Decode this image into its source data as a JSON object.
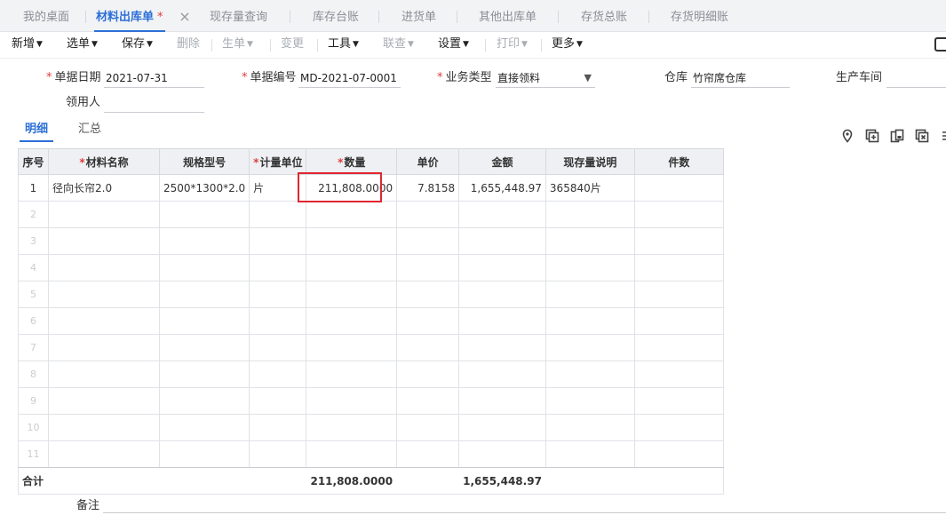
{
  "tabs": [
    {
      "label": "我的桌面",
      "active": false
    },
    {
      "label": "材料出库单",
      "active": true,
      "modified_mark": "*"
    },
    {
      "label": "现存量查询",
      "active": false
    },
    {
      "label": "库存台账",
      "active": false
    },
    {
      "label": "进货单",
      "active": false
    },
    {
      "label": "其他出库单",
      "active": false
    },
    {
      "label": "存货总账",
      "active": false
    },
    {
      "label": "存货明细账",
      "active": false
    }
  ],
  "toolbar": {
    "new": "新增",
    "select": "选单",
    "save": "保存",
    "delete": "删除",
    "generate": "生单",
    "change": "变更",
    "tools": "工具",
    "linked_query": "联查",
    "settings": "设置",
    "print": "打印",
    "more": "更多"
  },
  "form": {
    "date_label": "单据日期",
    "date_value": "2021-07-31",
    "number_label": "单据编号",
    "number_value": "MD-2021-07-0001",
    "biz_type_label": "业务类型",
    "biz_type_value": "直接领料",
    "warehouse_label": "仓库",
    "warehouse_value": "竹帘席仓库",
    "workshop_label": "生产车间",
    "workshop_value": "",
    "receiver_label": "领用人",
    "receiver_value": "",
    "remark_label": "备注",
    "remark_value": ""
  },
  "subtabs": {
    "detail": "明细",
    "summary": "汇总"
  },
  "grid": {
    "headers": {
      "seq": "序号",
      "name": "材料名称",
      "spec": "规格型号",
      "unit": "计量单位",
      "qty": "数量",
      "price": "单价",
      "amount": "金额",
      "stock_note": "现存量说明",
      "pieces": "件数"
    },
    "rows": [
      {
        "seq": "1",
        "name": "径向长帘2.0",
        "spec": "2500*1300*2.0",
        "unit": "片",
        "qty": "211,808.0000",
        "price": "7.8158",
        "amount": "1,655,448.97",
        "stock_note": "365840片",
        "pieces": ""
      }
    ],
    "empty_rows": [
      "2",
      "3",
      "4",
      "5",
      "6",
      "7",
      "8",
      "9",
      "10",
      "11"
    ],
    "total": {
      "label": "合计",
      "qty": "211,808.0000",
      "amount": "1,655,448.97"
    }
  },
  "colors": {
    "accent": "#2c6fd6",
    "required": "#e03c3c",
    "highlight_box": "#e0262f"
  }
}
